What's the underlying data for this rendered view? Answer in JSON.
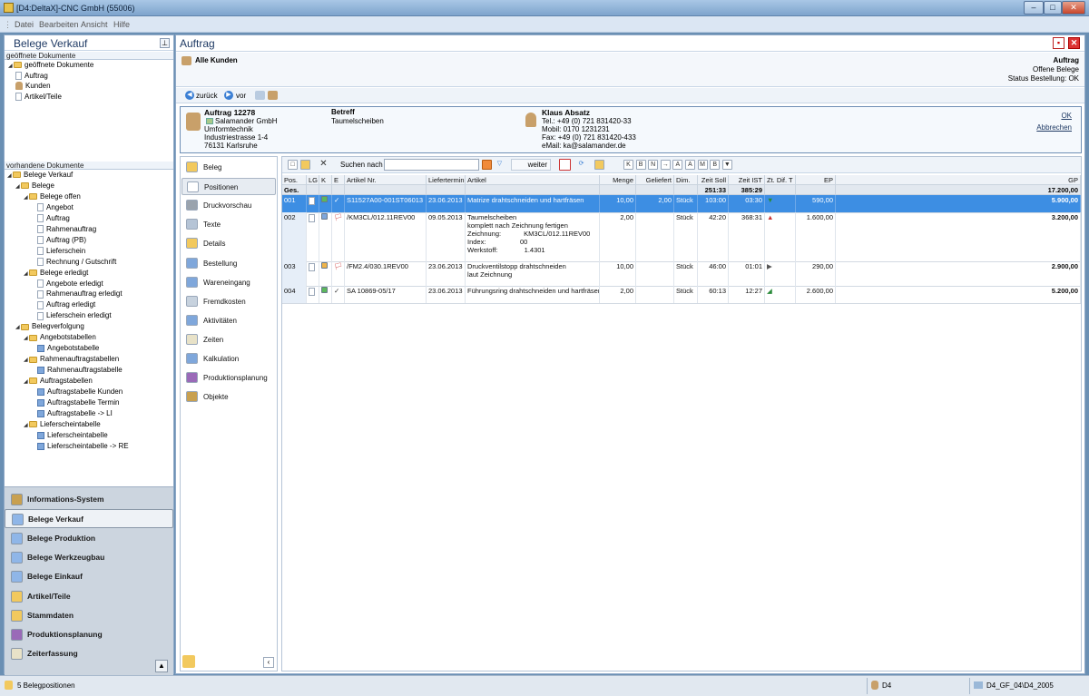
{
  "window": {
    "title": "[D4:DeltaX]-CNC GmbH (55006)",
    "min": "–",
    "max": "□",
    "close": "✕"
  },
  "menu": [
    "Datei",
    "Bearbeiten",
    "Ansicht",
    "Hilfe"
  ],
  "left": {
    "title": "Belege Verkauf",
    "pin": "⊥",
    "opened_header": "geöffnete Dokumente",
    "opened": [
      {
        "label": "geöffnete Dokumente",
        "icon": "folder"
      },
      {
        "label": "Auftrag",
        "icon": "doc"
      },
      {
        "label": "Kunden",
        "icon": "person"
      },
      {
        "label": "Artikel/Teile",
        "icon": "doc"
      }
    ],
    "existing_header": "vorhandene Dokumente",
    "tree": [
      {
        "label": "Belege Verkauf",
        "icon": "folder",
        "lvl": 0,
        "tri": "◢"
      },
      {
        "label": "Belege",
        "icon": "folder",
        "lvl": 1,
        "tri": "◢"
      },
      {
        "label": "Belege offen",
        "icon": "folder",
        "lvl": 2,
        "tri": "◢"
      },
      {
        "label": "Angebot",
        "icon": "doc",
        "lvl": 3
      },
      {
        "label": "Auftrag",
        "icon": "doc",
        "lvl": 3
      },
      {
        "label": "Rahmenauftrag",
        "icon": "doc",
        "lvl": 3
      },
      {
        "label": "Auftrag (PB)",
        "icon": "doc",
        "lvl": 3
      },
      {
        "label": "Lieferschein",
        "icon": "doc",
        "lvl": 3
      },
      {
        "label": "Rechnung / Gutschrift",
        "icon": "doc",
        "lvl": 3
      },
      {
        "label": "Belege erledigt",
        "icon": "folder",
        "lvl": 2,
        "tri": "◢"
      },
      {
        "label": "Angebote erledigt",
        "icon": "doc",
        "lvl": 3
      },
      {
        "label": "Rahmenauftrag erledigt",
        "icon": "doc",
        "lvl": 3
      },
      {
        "label": "Auftrag erledigt",
        "icon": "doc",
        "lvl": 3
      },
      {
        "label": "Lieferschein erledigt",
        "icon": "doc",
        "lvl": 3
      },
      {
        "label": "Belegverfolgung",
        "icon": "folder",
        "lvl": 1,
        "tri": "◢"
      },
      {
        "label": "Angebotstabellen",
        "icon": "folder",
        "lvl": 2,
        "tri": "◢"
      },
      {
        "label": "Angebotstabelle",
        "icon": "tbl",
        "lvl": 3
      },
      {
        "label": "Rahmenauftragstabellen",
        "icon": "folder",
        "lvl": 2,
        "tri": "◢"
      },
      {
        "label": "Rahmenauftragstabelle",
        "icon": "tbl",
        "lvl": 3
      },
      {
        "label": "Auftragstabellen",
        "icon": "folder",
        "lvl": 2,
        "tri": "◢"
      },
      {
        "label": "Auftragstabelle Kunden",
        "icon": "tbl",
        "lvl": 3
      },
      {
        "label": "Auftragstabelle Termin",
        "icon": "tbl",
        "lvl": 3
      },
      {
        "label": "Auftragstabelle -> LI",
        "icon": "tbl",
        "lvl": 3
      },
      {
        "label": "Lieferscheintabelle",
        "icon": "folder",
        "lvl": 2,
        "tri": "◢"
      },
      {
        "label": "Lieferscheintabelle",
        "icon": "tbl",
        "lvl": 3
      },
      {
        "label": "Lieferscheintabelle -> RE",
        "icon": "tbl",
        "lvl": 3
      }
    ],
    "nav": [
      {
        "label": "Informations-System",
        "color": "#c8a050"
      },
      {
        "label": "Belege Verkauf",
        "color": "#8fb6e8",
        "active": true
      },
      {
        "label": "Belege Produktion",
        "color": "#8fb6e8"
      },
      {
        "label": "Belege Werkzeugbau",
        "color": "#8fb6e8"
      },
      {
        "label": "Belege Einkauf",
        "color": "#8fb6e8"
      },
      {
        "label": "Artikel/Teile",
        "color": "#f2c95e"
      },
      {
        "label": "Stammdaten",
        "color": "#f2c95e"
      },
      {
        "label": "Produktionsplanung",
        "color": "#9a6ab8"
      },
      {
        "label": "Zeiterfassung",
        "color": "#e8e2c8"
      }
    ],
    "collapse": "▲"
  },
  "main": {
    "title": "Auftrag",
    "customer_label": "Alle Kunden",
    "info_right": [
      "Auftrag",
      "Offene Belege",
      "Status Bestellung: OK"
    ],
    "back": "zurück",
    "fwd": "vor",
    "order": {
      "number": "Auftrag 12278",
      "address": [
        "Salamander GmbH",
        "Umformtechnik",
        "Industriestrasse 1-4",
        "76131 Karlsruhe"
      ],
      "subject_label": "Betreff",
      "subject": "Taumelscheiben",
      "contact_name": "Klaus Absatz",
      "contact": [
        "Tel.: +49 (0) 721 831420-33",
        "Mobil: 0170 1231231",
        "Fax: +49 (0) 721 831420-433",
        "eMail: ka@salamander.de"
      ],
      "ok": "OK",
      "cancel": "Abbrechen"
    },
    "sidenav": [
      {
        "label": "Beleg",
        "color": "#f2c95e"
      },
      {
        "label": "Positionen",
        "color": "#ffffff",
        "active": true
      },
      {
        "label": "Druckvorschau",
        "color": "#9aa3ad"
      },
      {
        "label": "Texte",
        "color": "#b5c4d6"
      },
      {
        "label": "Details",
        "color": "#f2c95e"
      },
      {
        "label": "Bestellung",
        "color": "#7fa7db"
      },
      {
        "label": "Wareneingang",
        "color": "#7fa7db"
      },
      {
        "label": "Fremdkosten",
        "color": "#c7d2de"
      },
      {
        "label": "Aktivitäten",
        "color": "#7fa7db"
      },
      {
        "label": "Zeiten",
        "color": "#e8e2c8"
      },
      {
        "label": "Kalkulation",
        "color": "#7fa7db"
      },
      {
        "label": "Produktionsplanung",
        "color": "#9a6ab8"
      },
      {
        "label": "Objekte",
        "color": "#c8a050"
      }
    ],
    "search_label": "Suchen nach",
    "search_value": "",
    "weiter": "weiter",
    "tool_letters": [
      "K",
      "B",
      "N",
      "→",
      "A",
      "A",
      "M",
      "B",
      "▼"
    ],
    "columns": [
      "Pos.",
      "LG",
      "K",
      "E",
      "Artikel Nr.",
      "Liefertermin",
      "Artikel",
      "Menge",
      "Geliefert",
      "Dim.",
      "Zeit Soll",
      "Zeit IST",
      "Zt. Dif. T",
      "EP",
      "GP"
    ],
    "sum_label": "Ges.",
    "sum_zeit_soll": "251:33",
    "sum_zeit_ist": "385:29",
    "sum_gp": "17.200,00",
    "rows": [
      {
        "pos": "001",
        "e": "✓",
        "art_nr": "S11527A00-001ST06013",
        "termin": "23.06.2013",
        "artikel": [
          "Matrize drahtschneiden und hartfräsen"
        ],
        "menge": "10,00",
        "geliefert": "2,00",
        "dim": "Stück",
        "soll": "103:00",
        "ist": "03:30",
        "dif": "▼",
        "ep": "590,00",
        "gp": "5.900,00",
        "kcolor": "#5cb85c",
        "lgcolor": "#ffffff"
      },
      {
        "pos": "002",
        "e": "🏳",
        "art_nr": "/KM3CL/012.11REV00",
        "termin": "09.05.2013",
        "artikel": [
          "Taumelscheiben",
          "komplett nach Zeichnung fertigen",
          "Zeichnung:            KM3CL/012.11REV00",
          "Index:                  00",
          "Werkstoff:              1.4301"
        ],
        "menge": "2,00",
        "geliefert": "",
        "dim": "Stück",
        "soll": "42:20",
        "ist": "368:31",
        "dif": "▲",
        "ep": "1.600,00",
        "gp": "3.200,00",
        "kcolor": "#7fa7db",
        "lgcolor": "#ffffff"
      },
      {
        "pos": "003",
        "e": "🏳",
        "art_nr": "/FM2.4/030.1REV00",
        "termin": "23.06.2013",
        "artikel": [
          "Druckventilstopp drahtschneiden",
          "laut Zeichnung"
        ],
        "menge": "10,00",
        "geliefert": "",
        "dim": "Stück",
        "soll": "46:00",
        "ist": "01:01",
        "dif": "▶",
        "ep": "290,00",
        "gp": "2.900,00",
        "kcolor": "#f0b44a",
        "lgcolor": "#ffffff"
      },
      {
        "pos": "004",
        "e": "✓",
        "art_nr": "SA 10869-05/17",
        "termin": "23.06.2013",
        "artikel": [
          "Führungsring drahtschneiden und hartfräsen"
        ],
        "menge": "2,00",
        "geliefert": "",
        "dim": "Stück",
        "soll": "60:13",
        "ist": "12:27",
        "dif": "◢",
        "ep": "2.600,00",
        "gp": "5.200,00",
        "kcolor": "#5cb85c",
        "lgcolor": "#ffffff"
      }
    ]
  },
  "status": {
    "left": "5 Belegpositionen",
    "user": "D4",
    "right": "D4_GF_04\\D4_2005"
  }
}
